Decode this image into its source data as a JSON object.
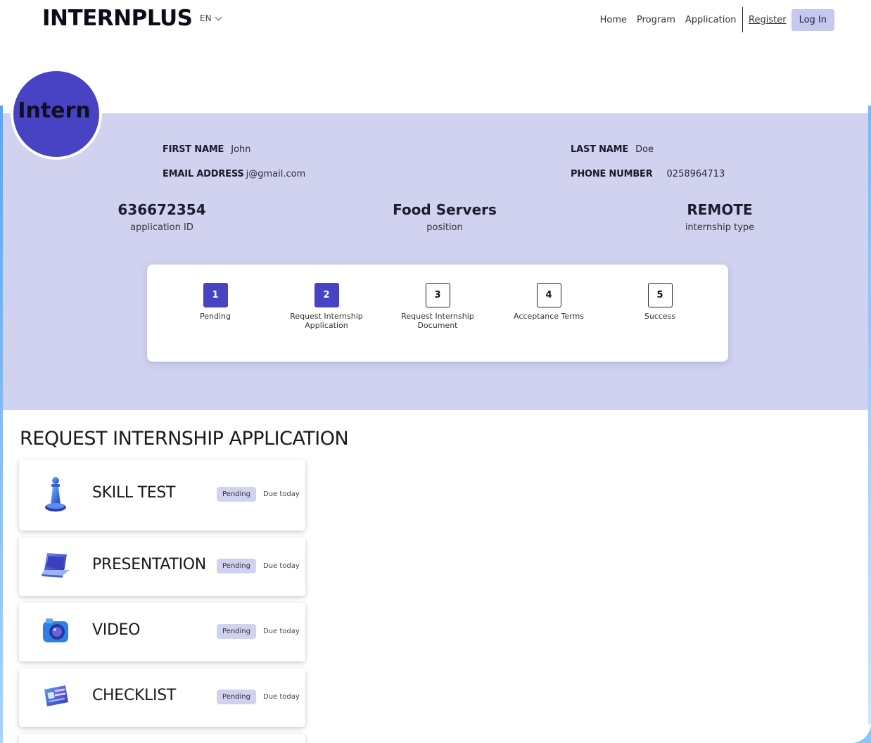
{
  "header": {
    "brand": "INTERNPLUS",
    "language": "EN",
    "nav": {
      "home": "Home",
      "program": "Program",
      "application": "Application",
      "register": "Register",
      "login": "Log In"
    }
  },
  "profile": {
    "avatar_text": "Intern",
    "first_name_label": "FIRST NAME",
    "first_name": "John",
    "last_name_label": "LAST NAME",
    "last_name": "Doe",
    "email_label": "EMAIL ADDRESS",
    "email": "j@gmail.com",
    "phone_label": "PHONE NUMBER",
    "phone": "0258964713"
  },
  "stats": [
    {
      "value": "636672354",
      "label": "application ID"
    },
    {
      "value": "Food Servers",
      "label": "position"
    },
    {
      "value": "REMOTE",
      "label": "internship type"
    }
  ],
  "steps": [
    {
      "number": "1",
      "label": "Pending",
      "active": true
    },
    {
      "number": "2",
      "label": "Request Internship Application",
      "active": true
    },
    {
      "number": "3",
      "label": "Request Internship Document",
      "active": false
    },
    {
      "number": "4",
      "label": "Acceptance Terms",
      "active": false
    },
    {
      "number": "5",
      "label": "Success",
      "active": false
    }
  ],
  "section_title": "REQUEST INTERNSHIP APPLICATION",
  "tasks": [
    {
      "name": "SKILL TEST",
      "status": "Pending",
      "due": "Due today",
      "icon": "chess-pawn-icon"
    },
    {
      "name": "PRESENTATION",
      "status": "Pending",
      "due": "Due today",
      "icon": "laptop-icon"
    },
    {
      "name": "VIDEO",
      "status": "Pending",
      "due": "Due today",
      "icon": "camera-icon"
    },
    {
      "name": "CHECKLIST",
      "status": "Pending",
      "due": "Due today",
      "icon": "id-card-icon"
    }
  ],
  "colors": {
    "accent": "#4743c3",
    "band": "#d1d1f0",
    "badge": "#d1d1f0",
    "frame": "#8ec2f5"
  }
}
